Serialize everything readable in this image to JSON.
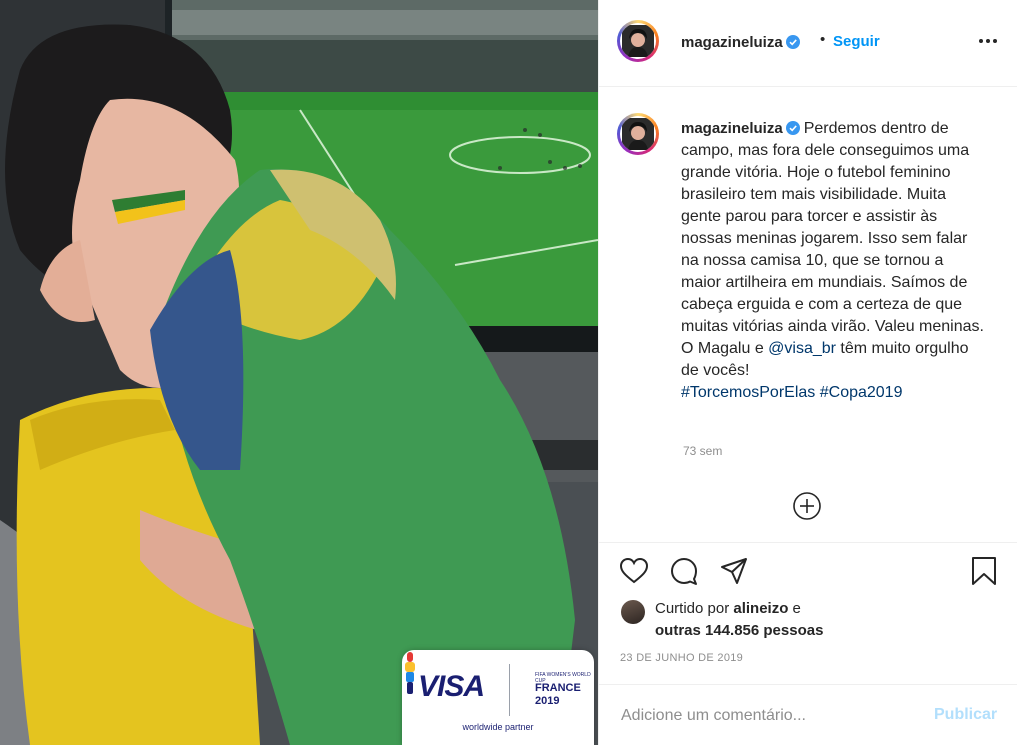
{
  "post": {
    "username": "magazineluiza",
    "verified_icon": "verified-badge-icon",
    "follow_separator": "•",
    "follow_label": "Seguir",
    "caption_before_mention": "Perdemos dentro de campo, mas fora dele conseguimos uma grande vitória. Hoje o futebol feminino brasileiro tem mais visibilidade. Muita gente parou para torcer e assistir às nossas meninas jogarem. Isso sem falar na nossa camisa 10, que se tornou a maior artilheira em mundiais. Saímos de cabeça erguida e com a certeza de que muitas vitórias ainda virão. Valeu meninas. O Magalu e ",
    "mention": "@visa_br",
    "caption_after_mention": " têm muito orgulho de vocês!",
    "hashtag_1": "#TorcemosPorElas",
    "hashtag_2": "#Copa2019",
    "time_ago": "73 sem",
    "liked_by_prefix": "Curtido por ",
    "liked_by_user": "alineizo",
    "liked_by_join": " e",
    "likes_others": "outras 144.856 pessoas",
    "date": "23 DE JUNHO DE 2019",
    "comment_placeholder": "Adicione um comentário...",
    "publish_label": "Publicar"
  },
  "media": {
    "partner_brand": "VISA",
    "partner_event_small": "FIFA WOMEN'S WORLD CUP",
    "partner_event_country": "FRANCE",
    "partner_event_year": "2019",
    "partner_caption": "worldwide partner"
  },
  "colors": {
    "link_blue": "#0095f6",
    "publish_disabled": "#b2dffc",
    "hashtag": "#00376b",
    "muted": "#8e8e8e",
    "visa_blue": "#1a1f71"
  }
}
